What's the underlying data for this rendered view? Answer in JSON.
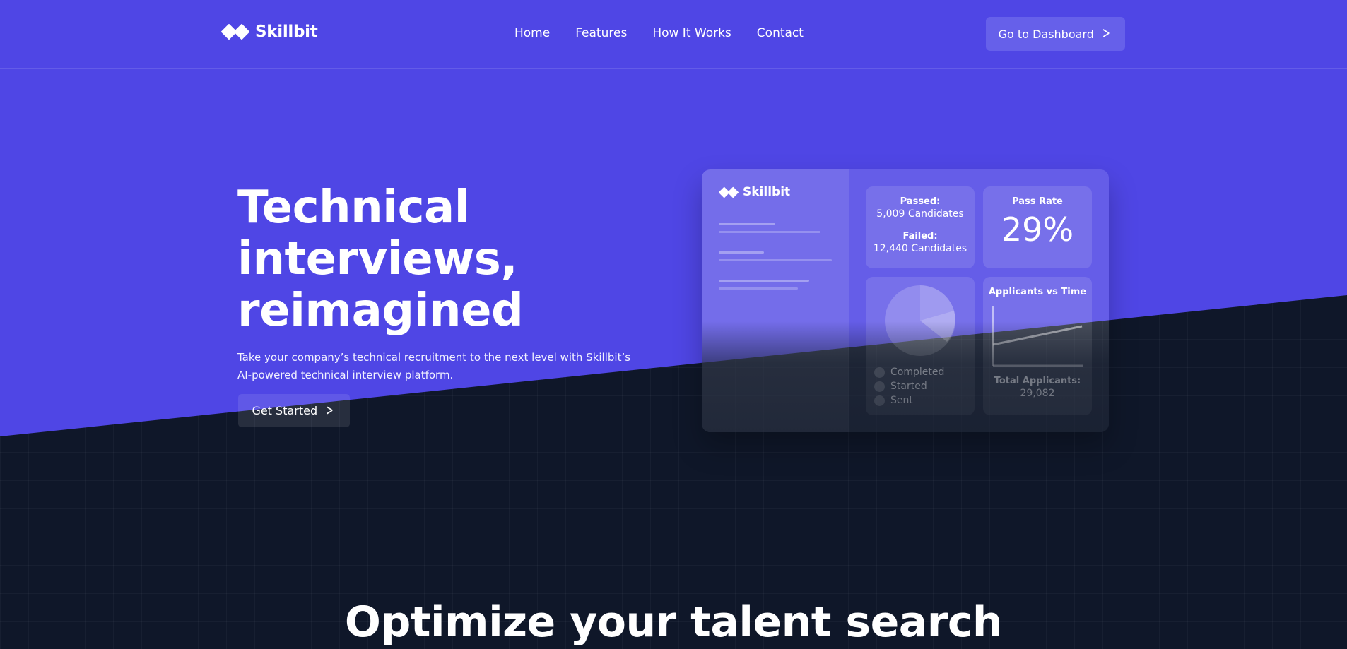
{
  "brand": {
    "name": "Skillbit",
    "logo_icon": "diamond-pair-icon"
  },
  "nav": {
    "links": [
      "Home",
      "Features",
      "How It Works",
      "Contact"
    ],
    "dashboard_button": "Go to Dashboard"
  },
  "hero": {
    "title_lines": [
      "Technical",
      "interviews,",
      "reimagined"
    ],
    "subtitle_lines": [
      "Take your company’s technical recruitment to the next level with Skillbit’s",
      "AI-powered technical interview platform."
    ],
    "cta": "Get Started"
  },
  "dashboard": {
    "logo": "Skillbit",
    "passed_label": "Passed:",
    "passed_value": "5,009 Candidates",
    "failed_label": "Failed:",
    "failed_value": "12,440 Candidates",
    "pass_rate_label": "Pass Rate",
    "pass_rate_value": "29%",
    "legend": [
      "Completed",
      "Started",
      "Sent"
    ],
    "chart_title": "Applicants vs Time",
    "total_label": "Total Applicants:",
    "total_value": "29,082"
  },
  "section": {
    "title": "Optimize your talent search"
  },
  "colors": {
    "primary": "#4f46e5",
    "dark_background": "#0f1729",
    "button_light": "#6660ea"
  }
}
